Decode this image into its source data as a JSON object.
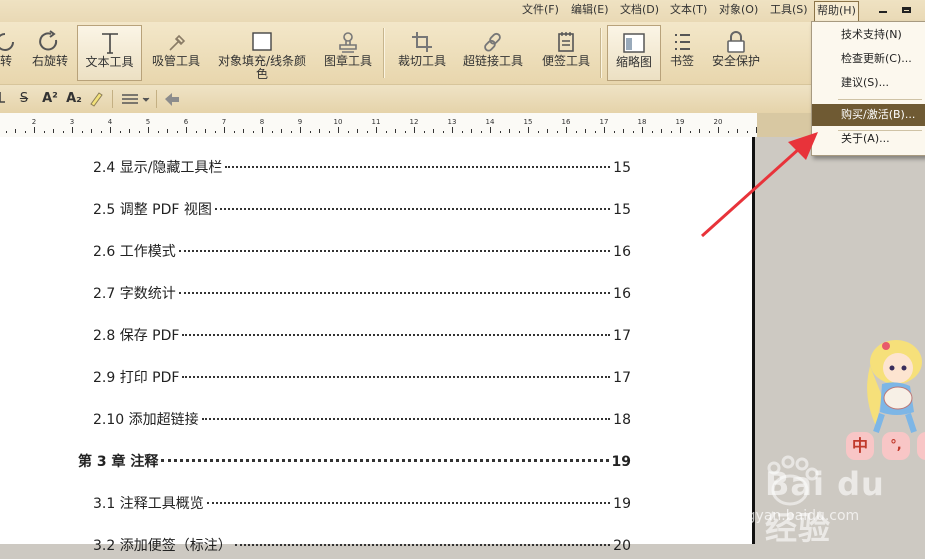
{
  "menubar": {
    "menus": [
      "文件(F)",
      "编辑(E)",
      "文档(D)",
      "文本(T)",
      "对象(O)",
      "工具(S)",
      "帮助(H)"
    ],
    "active_menu": "帮助(H)"
  },
  "toolbar": {
    "tools": [
      {
        "label": "转",
        "icon": "rotate-left-icon"
      },
      {
        "label": "右旋转",
        "icon": "rotate-right-icon"
      },
      {
        "label": "文本工具",
        "icon": "text-tool-icon",
        "selected": true
      },
      {
        "label": "吸管工具",
        "icon": "eyedropper-icon"
      },
      {
        "label": "对象填充/线条颜色",
        "icon": "fill-color-icon"
      },
      {
        "label": "图章工具",
        "icon": "stamp-icon"
      },
      {
        "label": "裁切工具",
        "icon": "crop-icon"
      },
      {
        "label": "超链接工具",
        "icon": "link-icon"
      },
      {
        "label": "便签工具",
        "icon": "note-icon"
      },
      {
        "label": "缩略图",
        "icon": "thumbnail-icon",
        "selected": true
      },
      {
        "label": "书签",
        "icon": "bookmark-icon"
      },
      {
        "label": "安全保护",
        "icon": "lock-icon"
      }
    ]
  },
  "formatbar": {
    "items": [
      "S",
      "A²",
      "A₂"
    ]
  },
  "ruler": {
    "numbers": [
      "2",
      "3",
      "4",
      "5",
      "6",
      "7",
      "8",
      "9",
      "10",
      "11",
      "12",
      "13",
      "14",
      "15",
      "16",
      "17",
      "18",
      "19",
      "20"
    ]
  },
  "toc": [
    {
      "title": "2.4 显示/隐藏工具栏",
      "page": "15",
      "chapter": false
    },
    {
      "title": "2.5 调整 PDF 视图",
      "page": "15",
      "chapter": false
    },
    {
      "title": "2.6 工作模式",
      "page": "16",
      "chapter": false
    },
    {
      "title": "2.7 字数统计",
      "page": "16",
      "chapter": false
    },
    {
      "title": "2.8 保存 PDF",
      "page": "17",
      "chapter": false
    },
    {
      "title": "2.9 打印 PDF",
      "page": "17",
      "chapter": false
    },
    {
      "title": "2.10 添加超链接",
      "page": "18",
      "chapter": false
    },
    {
      "title": "第 3 章  注释",
      "page": "19",
      "chapter": true
    },
    {
      "title": "3.1 注释工具概览",
      "page": "19",
      "chapter": false
    },
    {
      "title": "3.2 添加便签（标注）",
      "page": "20",
      "chapter": false
    }
  ],
  "help_menu": {
    "items": [
      "技术支持(N)",
      "检查更新(C)...",
      "建议(S)...",
      "购买/激活(B)...",
      "关于(A)..."
    ],
    "highlighted": "购买/激活(B)..."
  },
  "decor": {
    "bubbles": [
      "中",
      "°,"
    ],
    "watermark": "Bai du 经验",
    "watermark_sub": "jingyan.baidu.com"
  },
  "colors": {
    "toolbar_bg": "#e8d6ad",
    "menu_highlight": "#6f5a33",
    "annotation_arrow": "#e8333a"
  }
}
